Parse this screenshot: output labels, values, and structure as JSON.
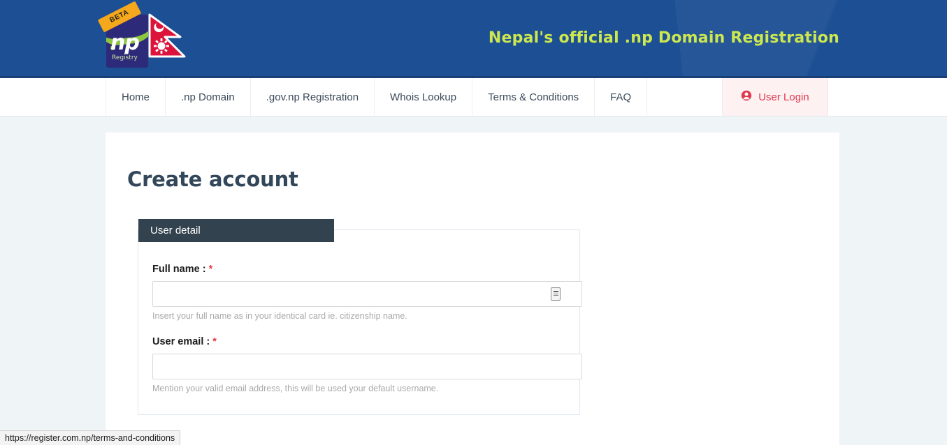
{
  "header": {
    "title": "Nepal's official .np Domain Registration",
    "logo": {
      "badge": "BETA",
      "wordmark": "np",
      "subtext": "Registry",
      "flag_name": "nepal-flag"
    },
    "colors": {
      "bar_blue": "#1c4f93",
      "title_green": "#cde84f",
      "logo_purple": "#2e2a7a",
      "logo_green": "#8dc63f",
      "badge_orange": "#f5a81c",
      "flag_red": "#dc143c",
      "flag_blue": "#003893"
    }
  },
  "nav": {
    "items": [
      {
        "label": "Home",
        "name": "nav-item-home"
      },
      {
        "label": ".np Domain",
        "name": "nav-item-np-domain"
      },
      {
        "label": ".gov.np Registration",
        "name": "nav-item-gov-np-registration"
      },
      {
        "label": "Whois Lookup",
        "name": "nav-item-whois-lookup"
      },
      {
        "label": "Terms & Conditions",
        "name": "nav-item-terms-and-conditions"
      },
      {
        "label": "FAQ",
        "name": "nav-item-faq"
      }
    ],
    "login": {
      "label": "User Login",
      "icon": "user-circle-icon",
      "bg": "#fdf1f2",
      "fg": "#e03a4e"
    }
  },
  "page": {
    "title": "Create account"
  },
  "form": {
    "panel_tab": "User detail",
    "fields": [
      {
        "label": "Full name :",
        "required": "*",
        "value": "",
        "placeholder": "",
        "hint": "Insert your full name as in your identical card ie. citizenship name.",
        "has_autofill_icon": true
      },
      {
        "label": "User email :",
        "required": "*",
        "value": "",
        "placeholder": "",
        "hint": "Mention your valid email address, this will be used your default username.",
        "has_autofill_icon": false
      }
    ]
  },
  "status_bar": {
    "url": "https://register.com.np/terms-and-conditions"
  }
}
